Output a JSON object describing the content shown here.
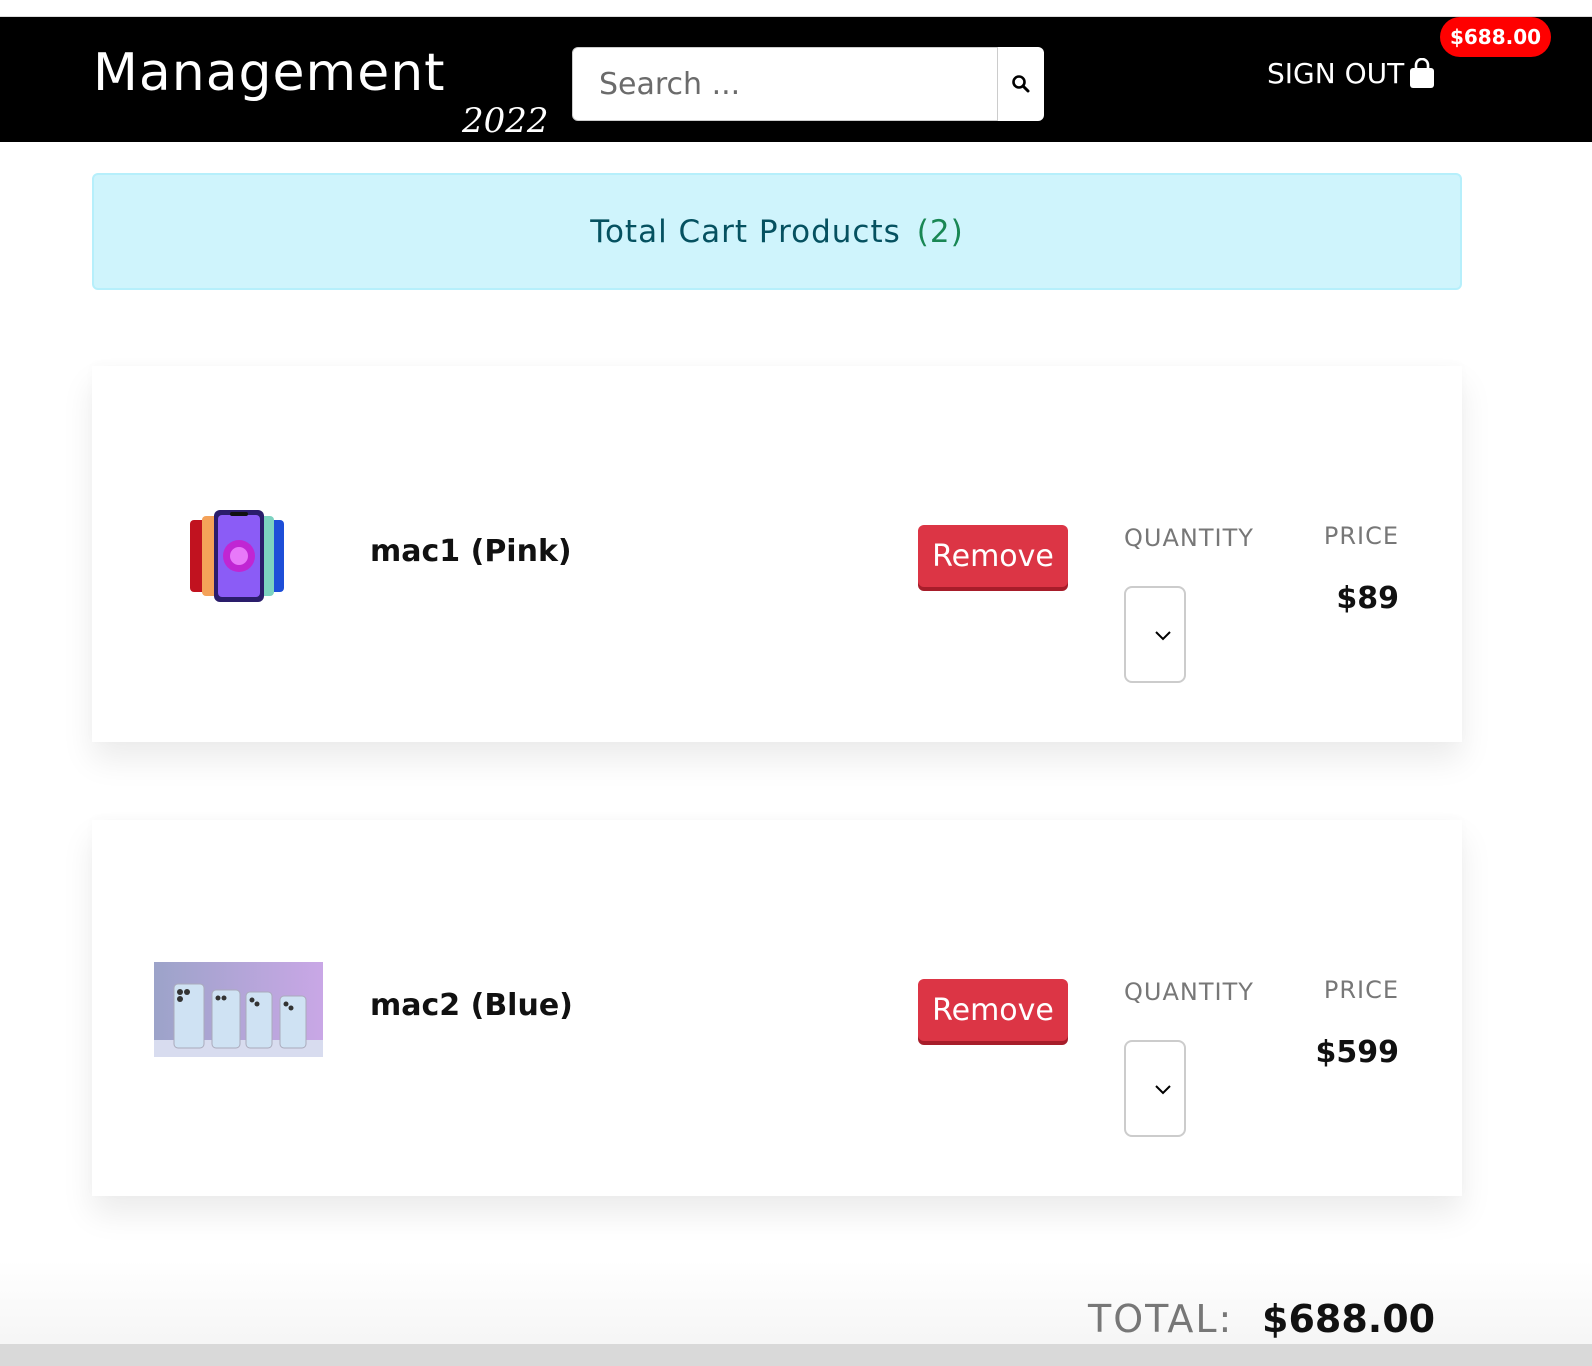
{
  "header": {
    "brand_title": "Management",
    "brand_year": "2022",
    "search_placeholder": "Search ...",
    "sign_out_label": "SIGN OUT",
    "cart_total_badge": "$688.00"
  },
  "alert": {
    "label": "Total Cart Products",
    "count": "(2)"
  },
  "cart": {
    "items": [
      {
        "name": "mac1 (Pink)",
        "remove_label": "Remove",
        "quantity_label": "QUANTITY",
        "price_label": "PRICE",
        "price": "$89",
        "image_icon": "colorful-phones-fan-image"
      },
      {
        "name": "mac2 (Blue)",
        "remove_label": "Remove",
        "quantity_label": "QUANTITY",
        "price_label": "PRICE",
        "price": "$599",
        "image_icon": "blue-phones-row-image"
      }
    ]
  },
  "summary": {
    "total_label": "TOTAL:",
    "total_value": "$688.00"
  },
  "colors": {
    "navbar": "#000000",
    "badge": "#ff0000",
    "remove": "#dc3545",
    "alert_bg": "#cff4fc",
    "alert_text": "#055160",
    "count_text": "#198754"
  }
}
